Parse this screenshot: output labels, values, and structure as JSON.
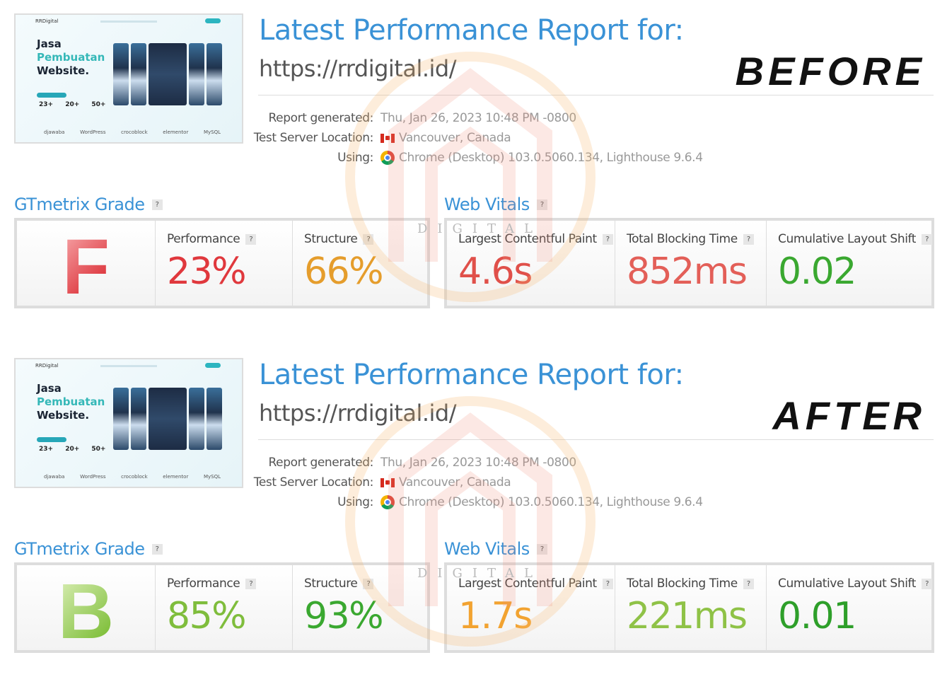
{
  "reports": [
    {
      "thumbnail": {
        "logo": "RRDigital",
        "heading": [
          "Jasa",
          "Pembuatan",
          "Website."
        ],
        "stats": "23+ 20+ 50+",
        "brands": [
          "djawaba",
          "WordPress",
          "crocoblock",
          "elementor",
          "MySQL"
        ]
      },
      "title": "Latest Performance Report for:",
      "url": "https://rrdigital.id/",
      "badge": "BEFORE",
      "meta": {
        "report_generated_label": "Report generated:",
        "report_generated": "Thu, Jan 26, 2023 10:48 PM -0800",
        "location_label": "Test Server Location:",
        "location": "Vancouver, Canada",
        "using_label": "Using:",
        "using": "Chrome (Desktop) 103.0.5060.134, Lighthouse 9.6.4"
      },
      "grade_section": "GTmetrix Grade",
      "vitals_section": "Web Vitals",
      "help": "?",
      "grade": {
        "letter": "F",
        "colors": [
          "#f6a5a8",
          "#d9232b"
        ]
      },
      "performance": {
        "label": "Performance",
        "value": "23%",
        "color": "#e0383d"
      },
      "structure": {
        "label": "Structure",
        "value": "66%",
        "color": "#e59d2c"
      },
      "lcp": {
        "label": "Largest Contentful Paint",
        "value": "4.6s",
        "color": "#e0504a"
      },
      "tbt": {
        "label": "Total Blocking Time",
        "value": "852ms",
        "color": "#e35f58"
      },
      "cls": {
        "label": "Cumulative Layout Shift",
        "value": "0.02",
        "color": "#3aa830"
      }
    },
    {
      "thumbnail": {
        "logo": "RRDigital",
        "heading": [
          "Jasa",
          "Pembuatan",
          "Website."
        ],
        "stats": "23+ 20+ 50+",
        "brands": [
          "djawaba",
          "WordPress",
          "crocoblock",
          "elementor",
          "MySQL"
        ]
      },
      "title": "Latest Performance Report for:",
      "url": "https://rrdigital.id/",
      "badge": "AFTER",
      "meta": {
        "report_generated_label": "Report generated:",
        "report_generated": "Thu, Jan 26, 2023 10:48 PM -0800",
        "location_label": "Test Server Location:",
        "location": "Vancouver, Canada",
        "using_label": "Using:",
        "using": "Chrome (Desktop) 103.0.5060.134, Lighthouse 9.6.4"
      },
      "grade_section": "GTmetrix Grade",
      "vitals_section": "Web Vitals",
      "help": "?",
      "grade": {
        "letter": "B",
        "colors": [
          "#d6ecb0",
          "#7fbf3a"
        ]
      },
      "performance": {
        "label": "Performance",
        "value": "85%",
        "color": "#7fbd3c"
      },
      "structure": {
        "label": "Structure",
        "value": "93%",
        "color": "#3aa830"
      },
      "lcp": {
        "label": "Largest Contentful Paint",
        "value": "1.7s",
        "color": "#f2a331"
      },
      "tbt": {
        "label": "Total Blocking Time",
        "value": "221ms",
        "color": "#8fc247"
      },
      "cls": {
        "label": "Cumulative Layout Shift",
        "value": "0.01",
        "color": "#2e9f2a"
      }
    }
  ],
  "watermark": {
    "text": "DIGITAL",
    "color": "#f5a04a"
  }
}
